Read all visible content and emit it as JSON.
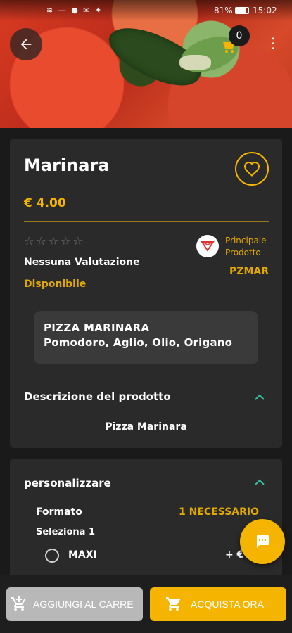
{
  "status_bar": {
    "icons": "≋ — ● ✉ ✦",
    "battery": "81%",
    "time": "15:02"
  },
  "header": {
    "cart_count": "0"
  },
  "product": {
    "title": "Marinara",
    "price": "€ 4.00",
    "stars": "☆☆☆☆☆",
    "rating_text": "Nessuna Valutazione",
    "availability": "Disponibile",
    "main_product_label": "Principale Prodotto",
    "sku": "PZMAR",
    "short_desc_line1": "PIZZA MARINARA",
    "short_desc_line2": "Pomodoro, Aglio, Olio, Origano"
  },
  "description_section": {
    "heading": "Descrizione del prodotto",
    "text": "Pizza Marinara"
  },
  "customize_section": {
    "heading": "personalizzare",
    "format_label": "Formato",
    "format_required": "1 NECESSARIO",
    "select_label": "Seleziona 1",
    "options": [
      {
        "name": "MAXI",
        "price": "+ €"
      }
    ]
  },
  "bottom_bar": {
    "add_to_cart": "AGGIUNGI AL CARRE",
    "buy_now": "ACQUISTA ORA"
  },
  "colors": {
    "accent": "#f5b400",
    "background": "#1a1a1a",
    "card": "#2a2a2a"
  },
  "icons": [
    "back-arrow-icon",
    "cart-icon",
    "more-vert-icon",
    "heart-icon",
    "brand-logo-icon",
    "chevron-up-icon",
    "chat-icon",
    "add-cart-icon",
    "shopping-cart-icon"
  ]
}
